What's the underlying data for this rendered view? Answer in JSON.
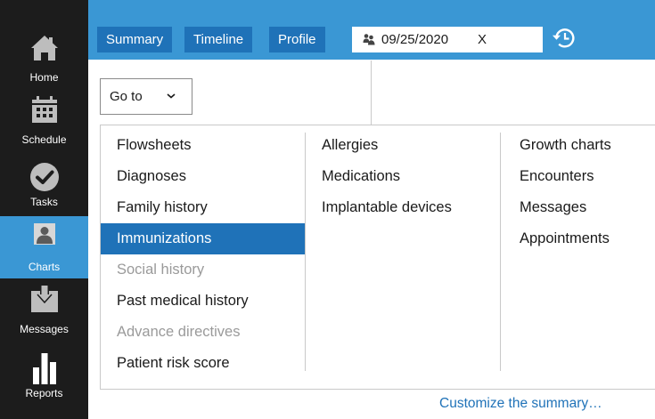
{
  "rail": {
    "items": [
      {
        "label": "Home",
        "icon": "home-icon"
      },
      {
        "label": "Schedule",
        "icon": "calendar-icon"
      },
      {
        "label": "Tasks",
        "icon": "checkmark-icon"
      },
      {
        "label": "Charts",
        "icon": "person-icon"
      },
      {
        "label": "Messages",
        "icon": "inbox-download-icon"
      },
      {
        "label": "Reports",
        "icon": "bar-chart-icon"
      }
    ],
    "active": "Charts"
  },
  "toolbar": {
    "tabs": [
      {
        "label": "Summary"
      },
      {
        "label": "Timeline"
      },
      {
        "label": "Profile"
      }
    ],
    "date_filter": {
      "value": "09/25/2020",
      "clear_label": "X",
      "icon": "people-icon"
    },
    "history_icon": "history-clock-icon"
  },
  "goto": {
    "label": "Go to",
    "chevron": "chevron-down-icon"
  },
  "menu": {
    "columns": [
      {
        "items": [
          {
            "label": "Flowsheets",
            "state": "normal"
          },
          {
            "label": "Diagnoses",
            "state": "normal"
          },
          {
            "label": "Family history",
            "state": "normal"
          },
          {
            "label": "Immunizations",
            "state": "selected"
          },
          {
            "label": "Social history",
            "state": "disabled"
          },
          {
            "label": "Past medical history",
            "state": "normal"
          },
          {
            "label": "Advance directives",
            "state": "disabled"
          },
          {
            "label": "Patient risk score",
            "state": "normal"
          }
        ]
      },
      {
        "items": [
          {
            "label": "Allergies",
            "state": "normal"
          },
          {
            "label": "Medications",
            "state": "normal"
          },
          {
            "label": "Implantable devices",
            "state": "normal"
          }
        ]
      },
      {
        "items": [
          {
            "label": "Growth charts",
            "state": "normal"
          },
          {
            "label": "Encounters",
            "state": "normal"
          },
          {
            "label": "Messages",
            "state": "normal"
          },
          {
            "label": "Appointments",
            "state": "normal"
          }
        ]
      }
    ]
  },
  "footer": {
    "customize_label": "Customize the summary…"
  },
  "colors": {
    "rail_bg": "#1c1c1c",
    "accent": "#3a97d4",
    "tab_bg": "#1f72b8",
    "disabled_text": "#9a9a9a"
  }
}
